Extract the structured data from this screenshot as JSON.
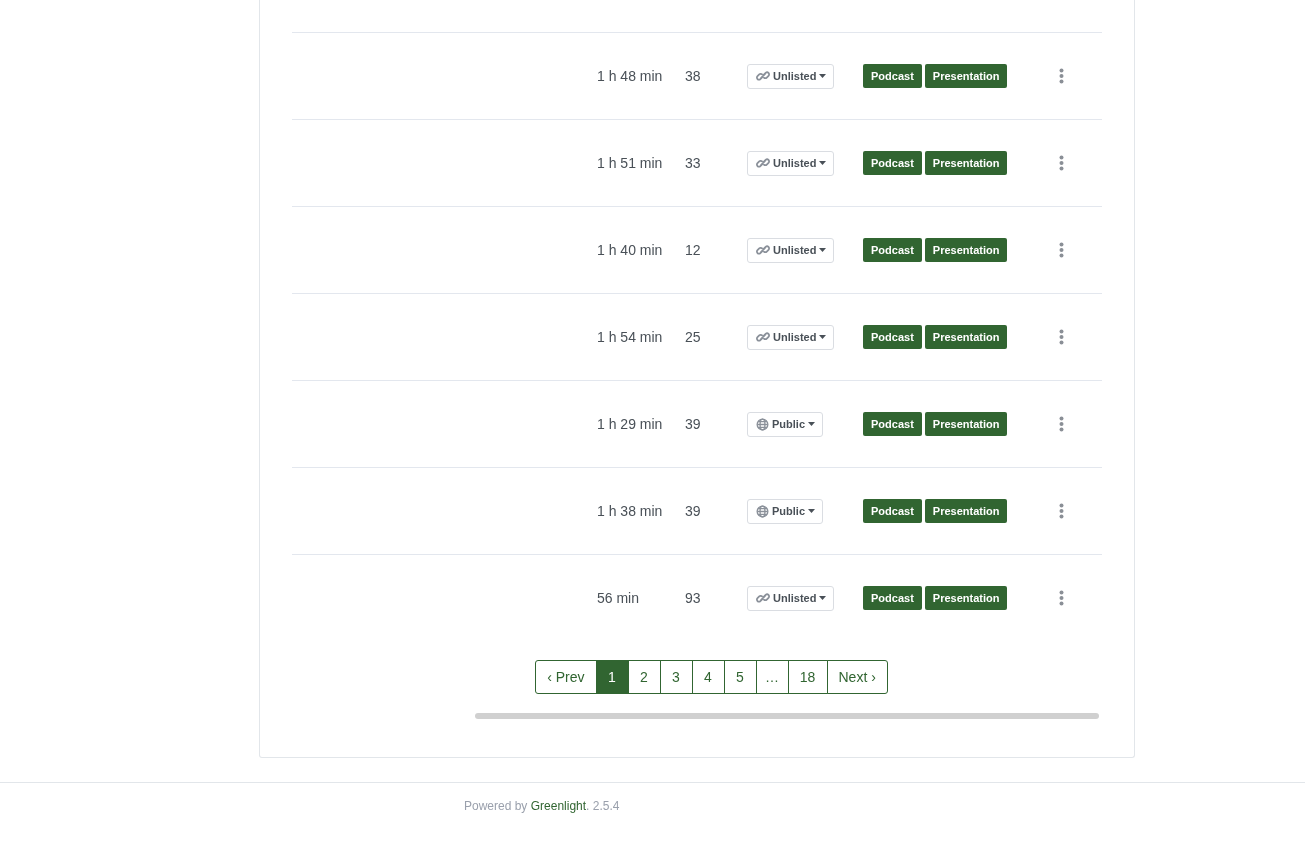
{
  "rows": [
    {
      "duration": "1 h 48 min",
      "views": "38",
      "visibility": {
        "kind": "unlisted",
        "label": "Unlisted"
      },
      "badges": [
        "Podcast",
        "Presentation"
      ]
    },
    {
      "duration": "1 h 51 min",
      "views": "33",
      "visibility": {
        "kind": "unlisted",
        "label": "Unlisted"
      },
      "badges": [
        "Podcast",
        "Presentation"
      ]
    },
    {
      "duration": "1 h 40 min",
      "views": "12",
      "visibility": {
        "kind": "unlisted",
        "label": "Unlisted"
      },
      "badges": [
        "Podcast",
        "Presentation"
      ]
    },
    {
      "duration": "1 h 54 min",
      "views": "25",
      "visibility": {
        "kind": "unlisted",
        "label": "Unlisted"
      },
      "badges": [
        "Podcast",
        "Presentation"
      ]
    },
    {
      "duration": "1 h 29 min",
      "views": "39",
      "visibility": {
        "kind": "public",
        "label": "Public"
      },
      "badges": [
        "Podcast",
        "Presentation"
      ]
    },
    {
      "duration": "1 h 38 min",
      "views": "39",
      "visibility": {
        "kind": "public",
        "label": "Public"
      },
      "badges": [
        "Podcast",
        "Presentation"
      ]
    },
    {
      "duration": "56 min",
      "views": "93",
      "visibility": {
        "kind": "unlisted",
        "label": "Unlisted"
      },
      "badges": [
        "Podcast",
        "Presentation"
      ]
    }
  ],
  "pagination": {
    "prev": "‹ Prev",
    "pages": [
      {
        "label": "1",
        "selected": true
      },
      {
        "label": "2",
        "selected": false
      },
      {
        "label": "3",
        "selected": false
      },
      {
        "label": "4",
        "selected": false
      },
      {
        "label": "5",
        "selected": false
      },
      {
        "label": "…",
        "selected": false
      },
      {
        "label": "18",
        "selected": false
      }
    ],
    "next": "Next ›"
  },
  "footer": {
    "prefix": "Powered by",
    "link": "Greenlight",
    "suffix": ". 2.5.4"
  }
}
